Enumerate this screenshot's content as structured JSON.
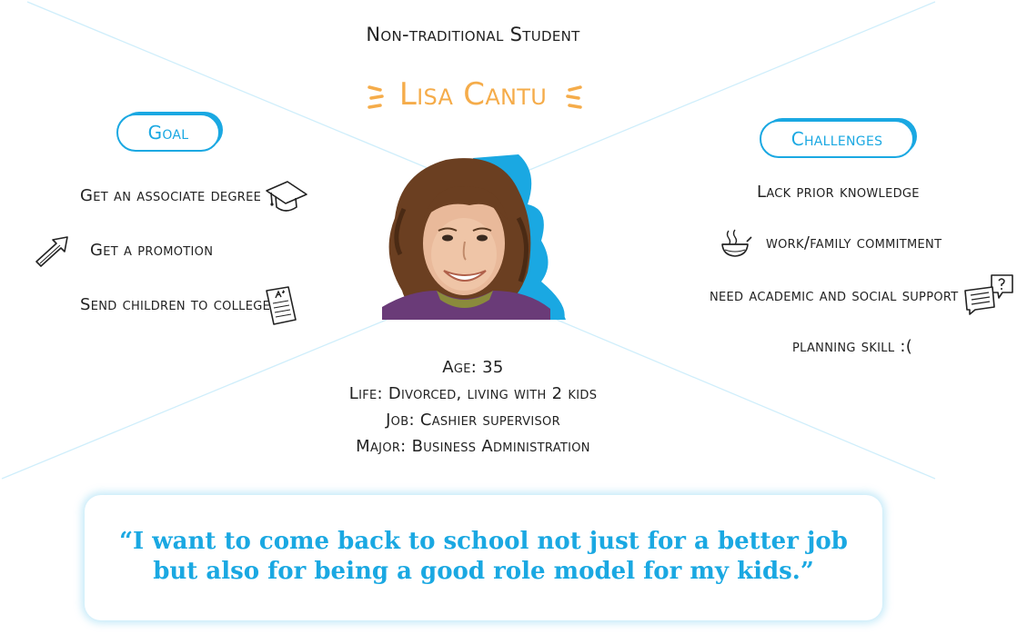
{
  "persona": {
    "subtitle": "Non-traditional Student",
    "name": "Lisa Cantu"
  },
  "goal": {
    "heading": "Goal",
    "items": [
      {
        "label": "Get an associate degree",
        "icon": "graduation-cap-icon"
      },
      {
        "label": "Get a promotion",
        "icon": "arrow-up-right-icon"
      },
      {
        "label": "Send children to college",
        "icon": "report-card-icon"
      }
    ]
  },
  "challenges": {
    "heading": "Challenges",
    "items": [
      {
        "label": "Lack prior knowledge",
        "icon": null
      },
      {
        "label": "work/family commitment",
        "icon": "cooking-pot-icon"
      },
      {
        "label": "need academic and social support",
        "icon": "chat-question-icon"
      },
      {
        "label": "planning skill :(",
        "icon": null
      }
    ]
  },
  "profile": {
    "age": "Age: 35",
    "life": "Life: Divorced, living with 2 kids",
    "job": "Job: Cashier supervisor",
    "major": "Major: Business Administration"
  },
  "quote": {
    "line1": "“I want to come back to school not just for a better job",
    "line2": "but also for being a good role model for my kids.”"
  },
  "colors": {
    "accent": "#1aa8e2",
    "name": "#f5ac4a",
    "lines": "#cfeefb"
  }
}
